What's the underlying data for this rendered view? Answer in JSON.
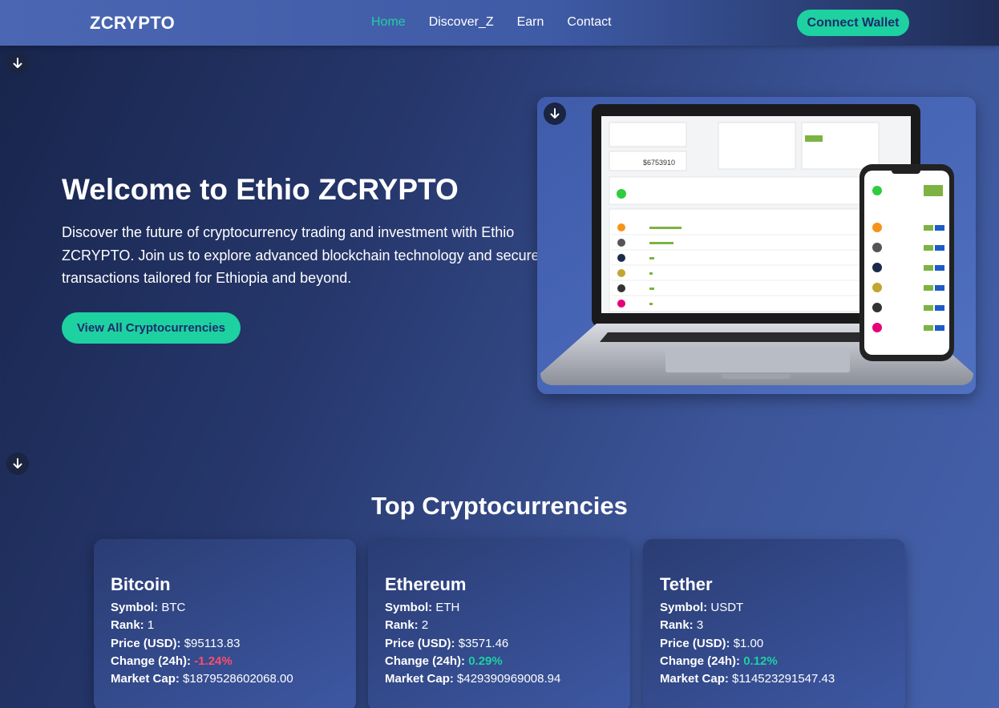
{
  "nav": {
    "logo": "ZCRYPTO",
    "links": [
      {
        "label": "Home",
        "active": true
      },
      {
        "label": "Discover_Z",
        "active": false
      },
      {
        "label": "Earn",
        "active": false
      },
      {
        "label": "Contact",
        "active": false
      }
    ],
    "connect_label": "Connect Wallet"
  },
  "hero": {
    "title": "Welcome to Ethio ZCRYPTO",
    "description": "Discover the future of cryptocurrency trading and investment with Ethio ZCRYPTO. Join us to explore advanced blockchain technology and secure transactions tailored for Ethiopia and beyond.",
    "cta_label": "View All Cryptocurrencies",
    "mockup": {
      "portfolio_value": "$6753910"
    }
  },
  "section": {
    "title": "Top Cryptocurrencies"
  },
  "labels": {
    "symbol": "Symbol:",
    "rank": "Rank:",
    "price": "Price (USD):",
    "change": "Change (24h):",
    "market_cap": "Market Cap:"
  },
  "cards": [
    {
      "name": "Bitcoin",
      "symbol": "BTC",
      "rank": "1",
      "price": "$95113.83",
      "change": "-1.24%",
      "market_cap": "$1879528602068.00"
    },
    {
      "name": "Ethereum",
      "symbol": "ETH",
      "rank": "2",
      "price": "$3571.46",
      "change": "0.29%",
      "market_cap": "$429390969008.94"
    },
    {
      "name": "Tether",
      "symbol": "USDT",
      "rank": "3",
      "price": "$1.00",
      "change": "0.12%",
      "market_cap": "$114523291547.43"
    }
  ],
  "colors": {
    "accent": "#1dd1a1",
    "negative": "#ff4d6a",
    "positive": "#1dd1a1"
  },
  "icons": [
    "arrow-down-icon",
    "bitcoin-icon",
    "ethereum-icon"
  ]
}
